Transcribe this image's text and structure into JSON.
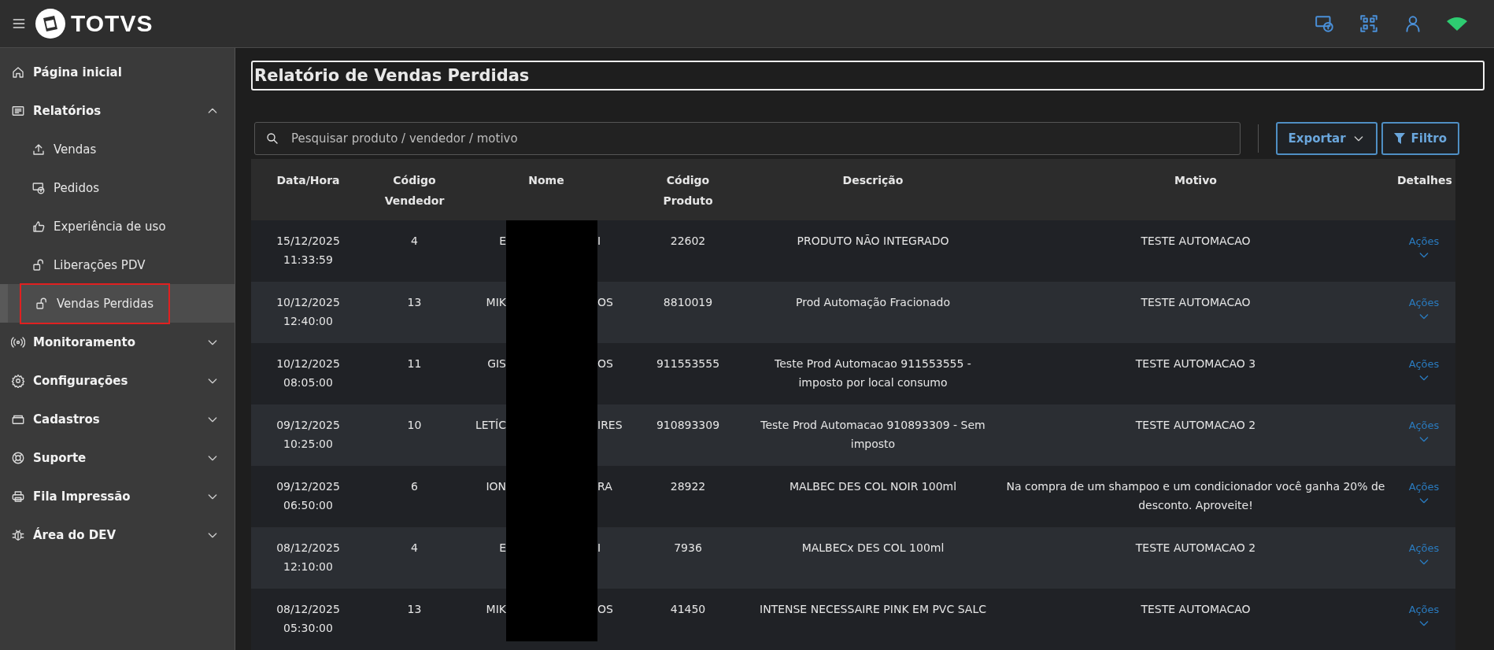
{
  "topbar": {
    "brand": "TOTVS"
  },
  "sidebar": {
    "items": [
      {
        "label": "Página inicial",
        "selected": false
      },
      {
        "label": "Relatórios",
        "selected": false,
        "expanded": true,
        "children": [
          {
            "label": "Vendas",
            "selected": false
          },
          {
            "label": "Pedidos",
            "selected": false
          },
          {
            "label": "Experiência de uso",
            "selected": false
          },
          {
            "label": "Liberações PDV",
            "selected": false
          },
          {
            "label": "Vendas Perdidas",
            "selected": true
          }
        ]
      },
      {
        "label": "Monitoramento",
        "selected": false,
        "expanded": false
      },
      {
        "label": "Configurações",
        "selected": false,
        "expanded": false
      },
      {
        "label": "Cadastros",
        "selected": false,
        "expanded": false
      },
      {
        "label": "Suporte",
        "selected": false,
        "expanded": false
      },
      {
        "label": "Fila Impressão",
        "selected": false,
        "expanded": false
      },
      {
        "label": "Área do DEV",
        "selected": false,
        "expanded": false
      }
    ]
  },
  "page": {
    "title": "Relatório de Vendas Perdidas"
  },
  "search": {
    "placeholder": "Pesquisar produto / vendedor / motivo"
  },
  "buttons": {
    "export": "Exportar",
    "filter": "Filtro"
  },
  "table": {
    "columns": [
      "Data/Hora",
      "Código Vendedor",
      "Nome",
      "Código Produto",
      "Descrição",
      "Motivo",
      "Detalhes"
    ],
    "rows": [
      {
        "datetime": "15/12/2025 11:33:59",
        "seller_code": "4",
        "name_start": "E",
        "name_end": "I",
        "product_code": "22602",
        "description": "PRODUTO NÃO INTEGRADO",
        "reason": "TESTE AUTOMACAO",
        "action": "Ações"
      },
      {
        "datetime": "10/12/2025 12:40:00",
        "seller_code": "13",
        "name_start": "MIK",
        "name_end": "OS",
        "product_code": "8810019",
        "description": "Prod Automação Fracionado",
        "reason": "TESTE AUTOMACAO",
        "action": "Ações"
      },
      {
        "datetime": "10/12/2025 08:05:00",
        "seller_code": "11",
        "name_start": "GIS",
        "name_end": "OS",
        "product_code": "911553555",
        "description": "Teste Prod Automacao 911553555 - imposto por local consumo",
        "reason": "TESTE AUTOMACAO 3",
        "action": "Ações"
      },
      {
        "datetime": "09/12/2025 10:25:00",
        "seller_code": "10",
        "name_start": "LETÍC",
        "name_end": "IRES",
        "product_code": "910893309",
        "description": "Teste Prod Automacao 910893309 - Sem imposto",
        "reason": "TESTE AUTOMACAO 2",
        "action": "Ações"
      },
      {
        "datetime": "09/12/2025 06:50:00",
        "seller_code": "6",
        "name_start": "ION",
        "name_end": "RA",
        "product_code": "28922",
        "description": "MALBEC DES COL NOIR 100ml",
        "reason": "Na compra de um shampoo e um condicionador você ganha 20% de desconto. Aproveite!",
        "action": "Ações"
      },
      {
        "datetime": "08/12/2025 12:10:00",
        "seller_code": "4",
        "name_start": "E",
        "name_end": "I",
        "product_code": "7936",
        "description": "MALBECx DES COL 100ml",
        "reason": "TESTE AUTOMACAO 2",
        "action": "Ações"
      },
      {
        "datetime": "08/12/2025 05:30:00",
        "seller_code": "13",
        "name_start": "MIK",
        "name_end": "OS",
        "product_code": "41450",
        "description": "INTENSE NECESSAIRE PINK EM PVC SALC",
        "reason": "TESTE AUTOMACAO",
        "action": "Ações"
      }
    ]
  }
}
